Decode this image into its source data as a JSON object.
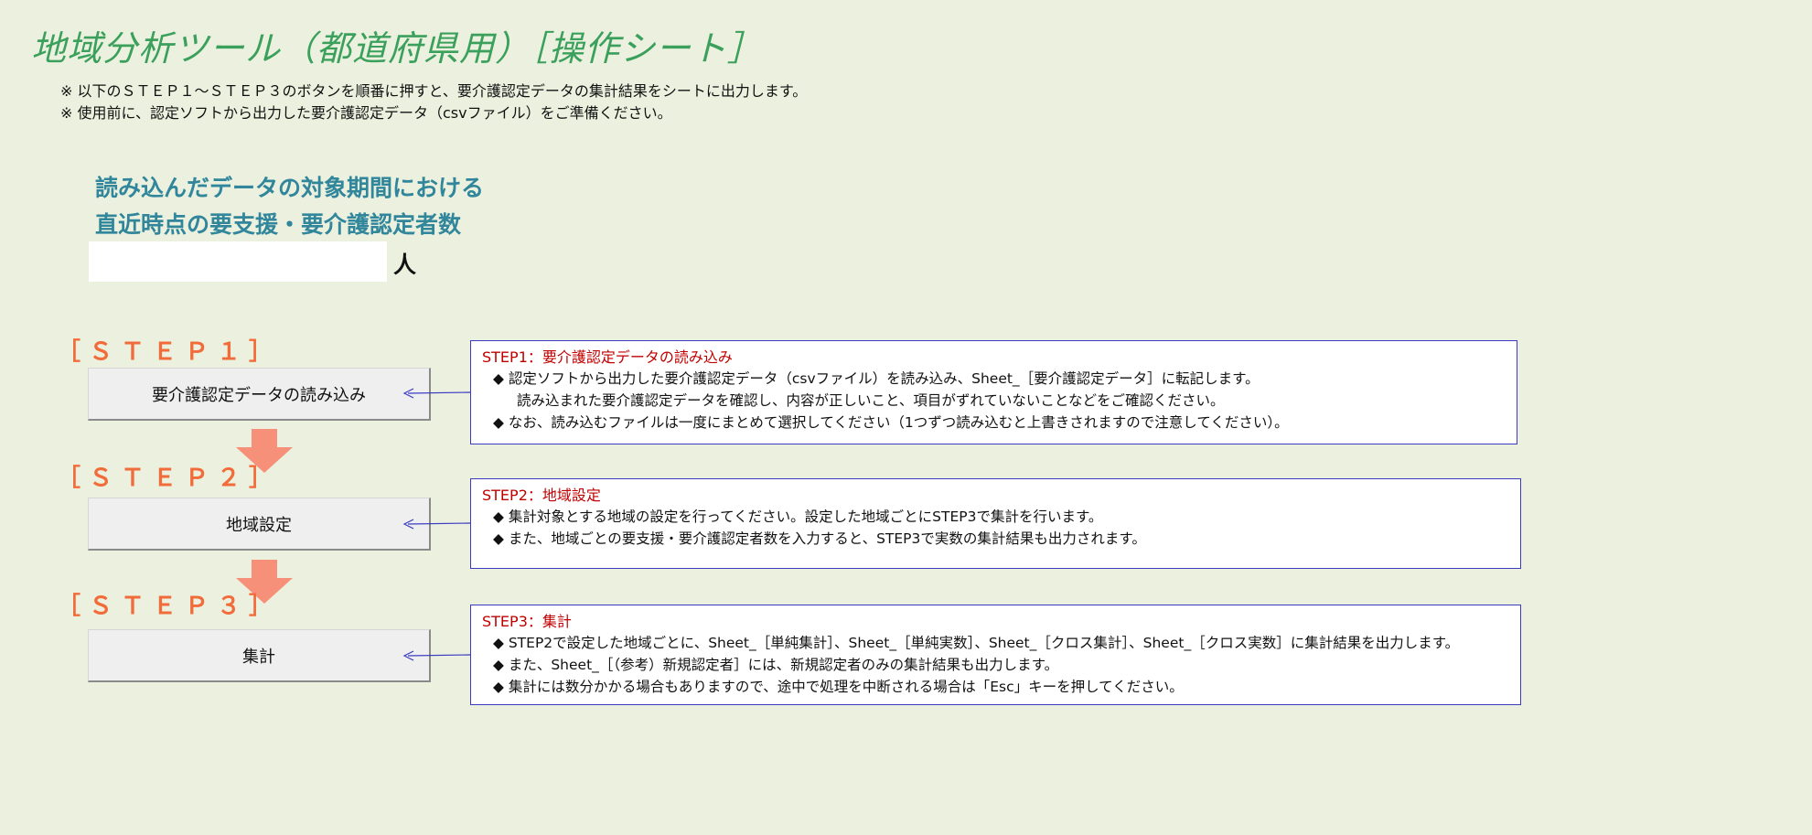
{
  "page": {
    "title": "地域分析ツール（都道府県用）［操作シート］",
    "notes": [
      "※ 以下のＳＴＥＰ１～ＳＴＥＰ３のボタンを順番に押すと、要介護認定データの集計結果をシートに出力します。",
      "※ 使用前に、認定ソフトから出力した要介護認定データ（csvファイル）をご準備ください。"
    ]
  },
  "count": {
    "heading_line1": "読み込んだデータの対象期間における",
    "heading_line2": "直近時点の要支援・要介護認定者数",
    "value": "",
    "unit": "人"
  },
  "steps": [
    {
      "label": "［ＳＴＥＰ１］",
      "button_label": "要介護認定データの読み込み",
      "desc_title": "STEP1：要介護認定データの読み込み",
      "desc_lines": [
        "◆  認定ソフトから出力した要介護認定データ（csvファイル）を読み込み、Sheet_［要介護認定データ］に転記します。",
        "読み込まれた要介護認定データを確認し、内容が正しいこと、項目がずれていないことなどをご確認ください。",
        "◆  なお、読み込むファイルは一度にまとめて選択してください（1つずつ読み込むと上書きされますので注意してください）。"
      ]
    },
    {
      "label": "［ＳＴＥＰ２］",
      "button_label": "地域設定",
      "desc_title": "STEP2：地域設定",
      "desc_lines": [
        "◆ 集計対象とする地域の設定を行ってください。設定した地域ごとにSTEP3で集計を行います。",
        "◆ また、地域ごとの要支援・要介護認定者数を入力すると、STEP3で実数の集計結果も出力されます。"
      ]
    },
    {
      "label": "［ＳＴＥＰ３］",
      "button_label": "集計",
      "desc_title": "STEP3：集計",
      "desc_lines": [
        "◆ STEP2で設定した地域ごとに、Sheet_［単純集計］、Sheet_［単純実数］、Sheet_［クロス集計］、Sheet_［クロス実数］に集計結果を出力します。",
        "◆ また、Sheet_［（参考）新規認定者］には、新規認定者のみの集計結果も出力します。",
        "◆ 集計には数分かかる場合もありますので、途中で処理を中断される場合は「Esc」キーを押してください。"
      ]
    }
  ],
  "colors": {
    "background": "#ebf1de",
    "title": "#3aa05c",
    "heading": "#31869b",
    "step_label": "#f26b3a",
    "arrow": "#f79078",
    "desc_border": "#3a3ac2",
    "desc_title": "#c00000"
  },
  "icons": {
    "down_arrow": "down-arrow-icon",
    "connector": "left-arrow-icon"
  }
}
